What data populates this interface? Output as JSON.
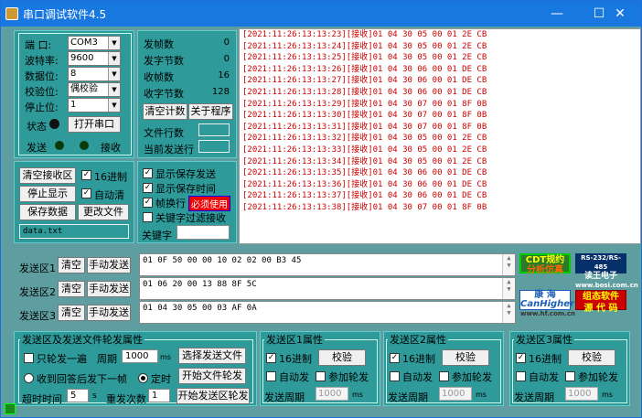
{
  "title": "串口调试软件4.5",
  "port": {
    "port_label": "端  口:",
    "port_value": "COM3",
    "baud_label": "波特率:",
    "baud_value": "9600",
    "databits_label": "数据位:",
    "databits_value": "8",
    "parity_label": "校验位:",
    "parity_value": "偶校验",
    "stopbits_label": "停止位:",
    "stopbits_value": "1",
    "status_label": "状态",
    "open_button": "打开串口",
    "send_label": "发送",
    "recv_label": "接收"
  },
  "stats": {
    "sent_frames_label": "发帧数",
    "sent_frames": "0",
    "sent_bytes_label": "发字节数",
    "sent_bytes": "0",
    "recv_frames_label": "收帧数",
    "recv_frames": "16",
    "recv_bytes_label": "收字节数",
    "recv_bytes": "128",
    "clear_count_button": "清空计数",
    "about_button": "关于程序",
    "file_lines_label": "文件行数",
    "current_line_label": "当前发送行"
  },
  "recv_ctrl": {
    "clear_recv_button": "清空接收区",
    "hex_label": "16进制",
    "stop_display_button": "停止显示",
    "auto_clear_label": "自动清",
    "save_data_button": "保存数据",
    "change_file_button": "更改文件",
    "filename": "data.txt"
  },
  "save_opts": {
    "show_save_send": "显示保存发送",
    "show_save_time": "显示保存时间",
    "frame_newline": "帧换行",
    "frame_newline_tag": "必须使用",
    "keyword_filter": "关键字过滤接收",
    "keyword_label": "关键字"
  },
  "log_lines": [
    "[2021:11:26:13:13:23][接收]01 04 30 05 00 01 2E CB",
    "[2021:11:26:13:13:24][接收]01 04 30 05 00 01 2E CB",
    "[2021:11:26:13:13:25][接收]01 04 30 05 00 01 2E CB",
    "[2021:11:26:13:13:26][接收]01 04 30 06 00 01 DE CB",
    "[2021:11:26:13:13:27][接收]01 04 30 06 00 01 DE CB",
    "[2021:11:26:13:13:28][接收]01 04 30 06 00 01 DE CB",
    "[2021:11:26:13:13:29][接收]01 04 30 07 00 01 8F 0B",
    "[2021:11:26:13:13:30][接收]01 04 30 07 00 01 8F 0B",
    "[2021:11:26:13:13:31][接收]01 04 30 07 00 01 8F 0B",
    "[2021:11:26:13:13:32][接收]01 04 30 05 00 01 2E CB",
    "[2021:11:26:13:13:33][接收]01 04 30 05 00 01 2E CB",
    "[2021:11:26:13:13:34][接收]01 04 30 05 00 01 2E CB",
    "[2021:11:26:13:13:35][接收]01 04 30 06 00 01 DE CB",
    "[2021:11:26:13:13:36][接收]01 04 30 06 00 01 DE CB",
    "[2021:11:26:13:13:37][接收]01 04 30 06 00 01 DE CB",
    "[2021:11:26:13:13:38][接收]01 04 30 07 00 01 8F 0B"
  ],
  "send_areas": [
    {
      "label": "发送区1",
      "clear": "清空",
      "manual": "手动发送",
      "data": "01 0F 50 00 00 10 02 02 00 B3 45"
    },
    {
      "label": "发送区2",
      "clear": "清空",
      "manual": "手动发送",
      "data": "01 06 20 00 13 88 8F 5C"
    },
    {
      "label": "发送区3",
      "clear": "清空",
      "manual": "手动发送",
      "data": "01 04 30 05 00 03 AF 0A"
    }
  ],
  "ads": {
    "ad1_line1": "CDT规约",
    "ad1_line2": "分析仿真",
    "ad2_line1": "RS-232/RS-485",
    "ad2_line2": "读王电子",
    "ad2_line3": "www.bosi.com.cn",
    "ad3_line1": "康 海",
    "ad3_line2": "CanHigher",
    "ad3_line3": "www.hf.com.cn",
    "ad4_line1": "组态软件",
    "ad4_line2": "源 代 码"
  },
  "rotation": {
    "title": "发送区及发送文件轮发属性",
    "only_once": "只轮发一遍",
    "period_label": "周期",
    "period_value": "1000",
    "ms": "ms",
    "select_file_button": "选择发送文件",
    "wait_reply": "收到回答后发下一帧",
    "timed": "定时",
    "start_file_button": "开始文件轮发",
    "timeout_label": "超时时间",
    "timeout_value": "5",
    "s_unit": "s",
    "resend_label": "重发次数",
    "resend_value": "1",
    "start_area_button": "开始发送区轮发"
  },
  "area_props": [
    {
      "title": "发送区1属性",
      "hex": "16进制",
      "verify": "校验",
      "auto": "自动发",
      "join": "参加轮发",
      "period_label": "发送周期",
      "period_value": "1000",
      "ms": "ms"
    },
    {
      "title": "发送区2属性",
      "hex": "16进制",
      "verify": "校验",
      "auto": "自动发",
      "join": "参加轮发",
      "period_label": "发送周期",
      "period_value": "1000",
      "ms": "ms"
    },
    {
      "title": "发送区3属性",
      "hex": "16进制",
      "verify": "校验",
      "auto": "自动发",
      "join": "参加轮发",
      "period_label": "发送周期",
      "period_value": "1000",
      "ms": "ms"
    }
  ]
}
